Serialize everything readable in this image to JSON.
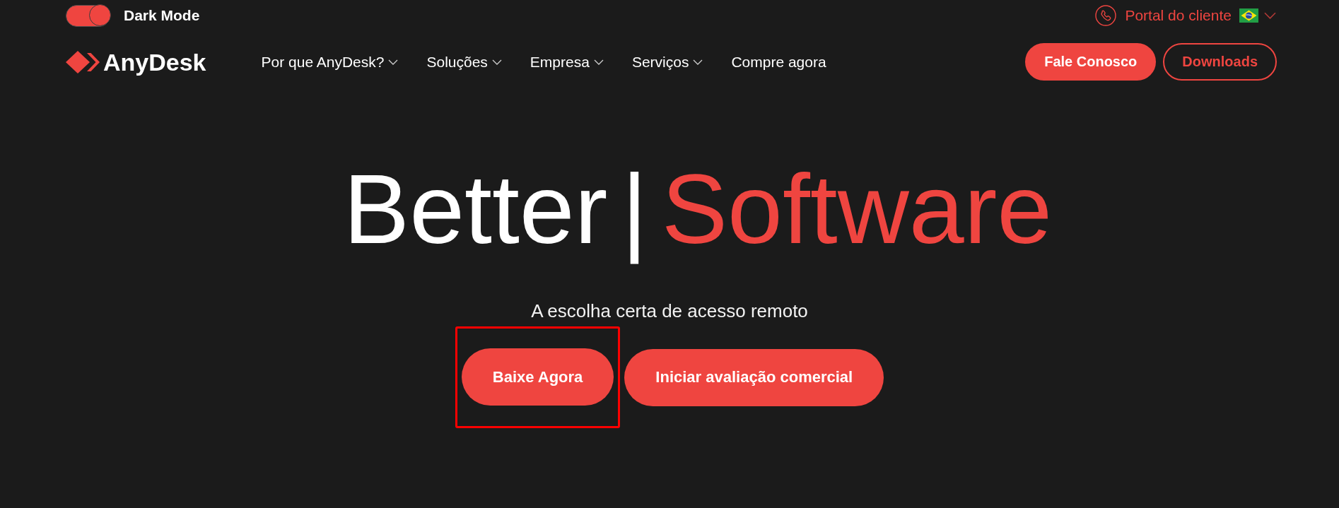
{
  "top_bar": {
    "dark_mode_toggle": {
      "label": "Dark Mode",
      "on": true
    },
    "portal_link": {
      "label": "Portal do cliente"
    }
  },
  "header": {
    "logo": {
      "text": "AnyDesk"
    },
    "nav": [
      {
        "label": "Por que AnyDesk?",
        "dropdown": true
      },
      {
        "label": "Soluções",
        "dropdown": true
      },
      {
        "label": "Empresa",
        "dropdown": true
      },
      {
        "label": "Serviços",
        "dropdown": true
      },
      {
        "label": "Compre agora",
        "dropdown": false
      }
    ],
    "buttons": [
      {
        "label": "Fale Conosco",
        "kind": "filled"
      },
      {
        "label": "Downloads",
        "kind": "outline"
      }
    ]
  },
  "hero": {
    "title": {
      "lead": "Better",
      "separator": "|",
      "accent": "Software"
    },
    "subtitle": "A escolha certa de acesso remoto",
    "buttons": [
      {
        "label": "Baixe Agora",
        "highlighted": true
      },
      {
        "label": "Iniciar avaliação comercial",
        "highlighted": false
      }
    ]
  }
}
